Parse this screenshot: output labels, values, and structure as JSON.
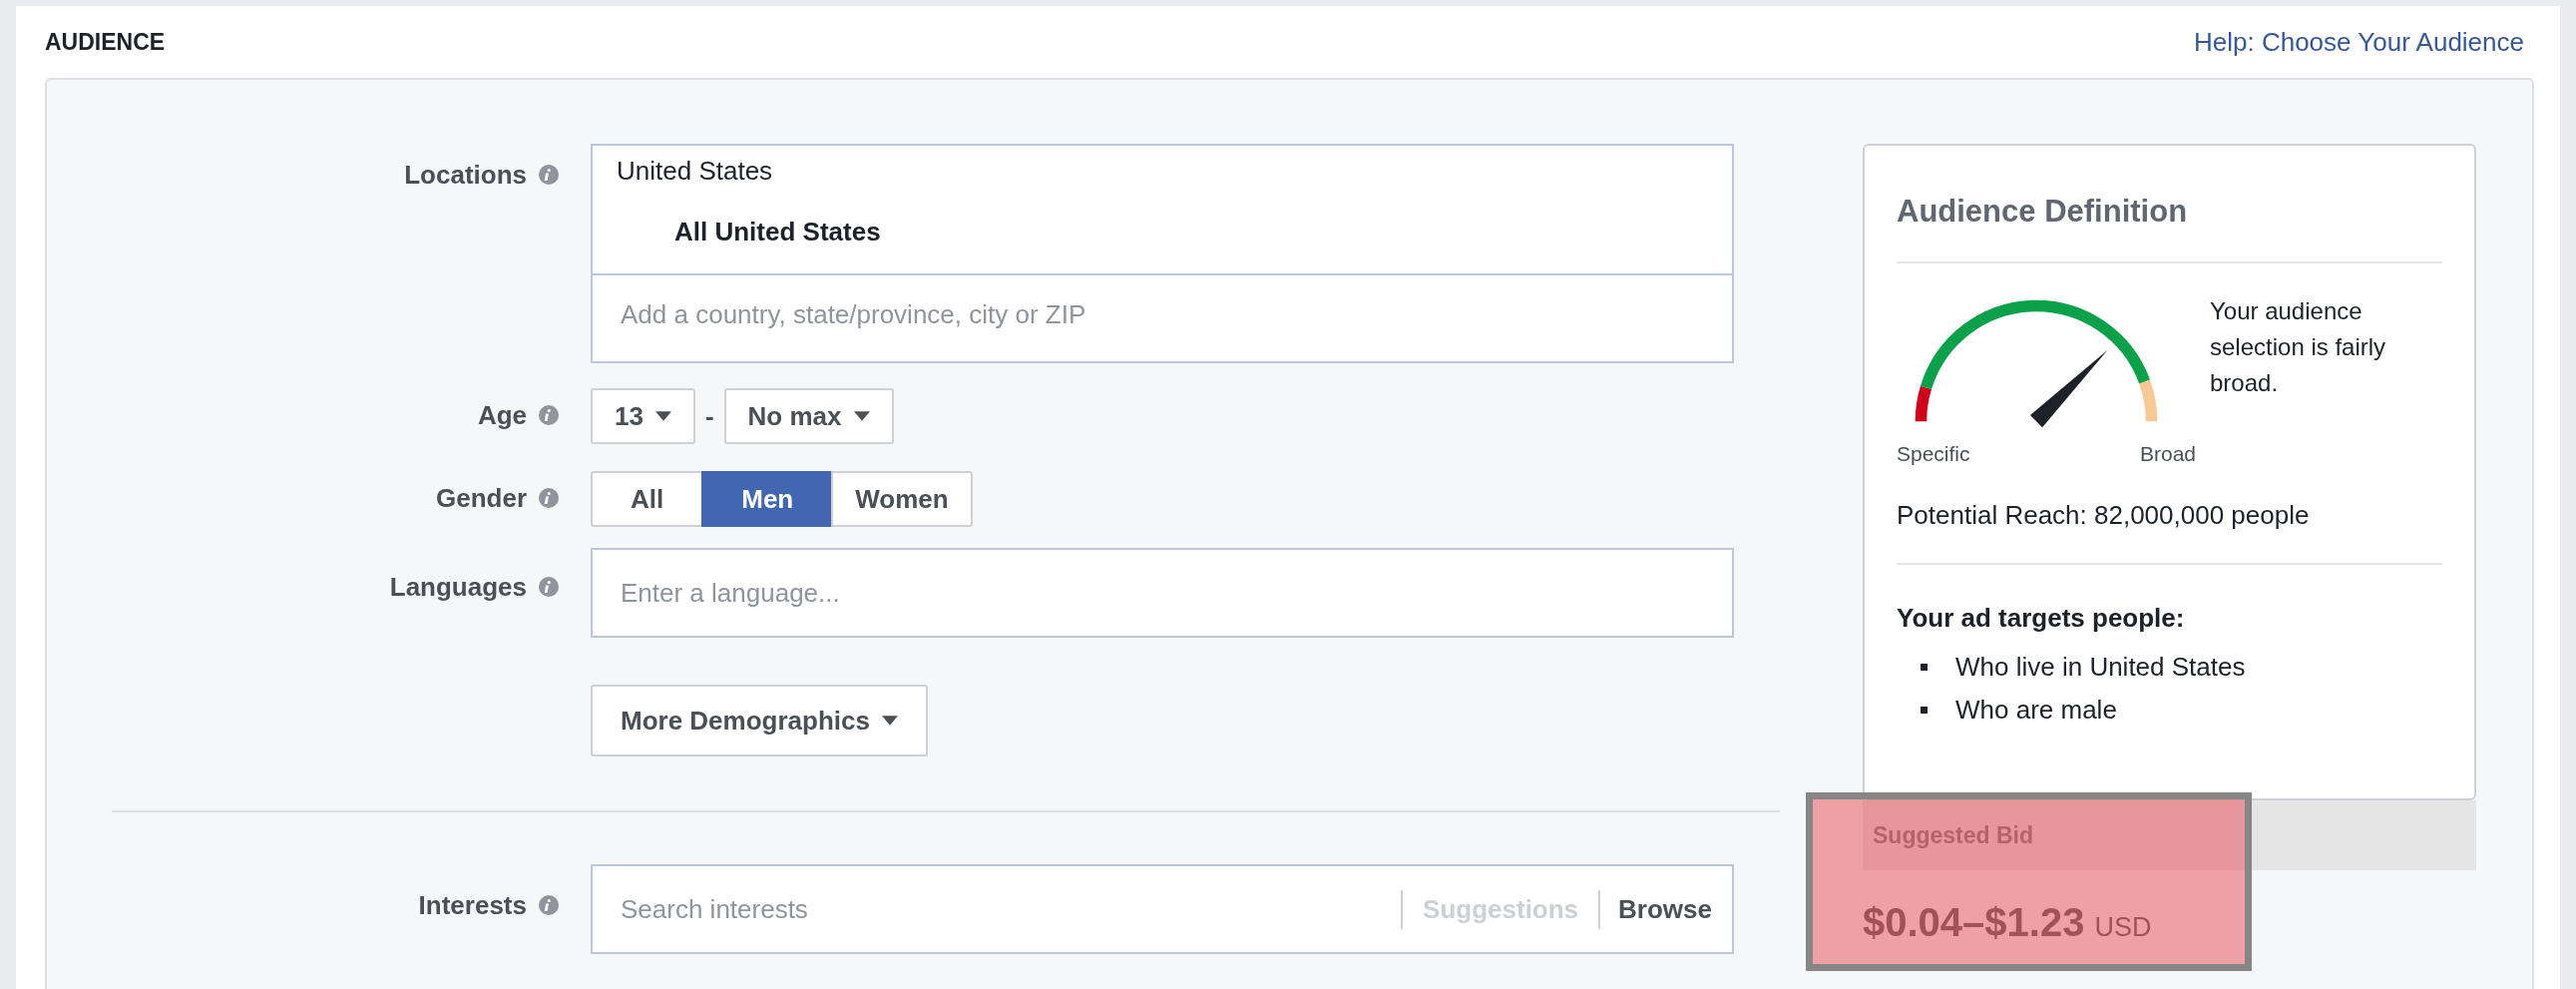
{
  "section": {
    "title": "AUDIENCE",
    "help_link": "Help: Choose Your Audience"
  },
  "locations": {
    "label": "Locations",
    "selected": "United States",
    "scope": "All United States",
    "placeholder": "Add a country, state/province, city or ZIP"
  },
  "age": {
    "label": "Age",
    "min": "13",
    "separator": "-",
    "max": "No max"
  },
  "gender": {
    "label": "Gender",
    "options": [
      {
        "label": "All",
        "selected": false
      },
      {
        "label": "Men",
        "selected": true
      },
      {
        "label": "Women",
        "selected": false
      }
    ]
  },
  "languages": {
    "label": "Languages",
    "placeholder": "Enter a language..."
  },
  "more_demographics": "More Demographics",
  "interests": {
    "label": "Interests",
    "placeholder": "Search interests",
    "suggestions": "Suggestions",
    "suggestions_disabled": true,
    "browse": "Browse"
  },
  "audience_definition": {
    "title": "Audience Definition",
    "gauge": {
      "min_label": "Specific",
      "max_label": "Broad"
    },
    "description": "Your audience selection is fairly broad.",
    "potential_reach": "Potential Reach: 82,000,000 people",
    "targets_heading": "Your ad targets people:",
    "targets": [
      "Who live in United States",
      "Who are male"
    ]
  },
  "suggested_bid": {
    "label": "Suggested Bid",
    "range": "$0.04–$1.23",
    "currency": "USD",
    "highlighted": true
  }
}
